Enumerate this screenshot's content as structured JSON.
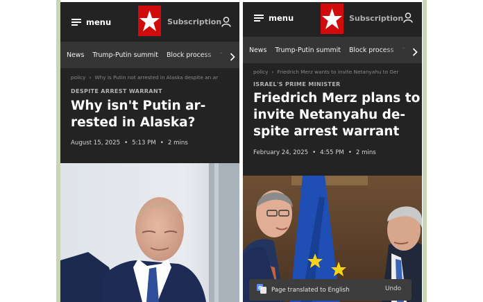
{
  "colors": {
    "background": "#232323",
    "nav_strip": "#353535",
    "logo_red": "#d10b0b",
    "frame_green": "#c9d6b6",
    "eu_flag_blue": "#1f4fb4",
    "eu_star_yellow": "#f6d31a"
  },
  "panels": [
    {
      "menu_label": "menu",
      "menu_icon": "hamburger-icon",
      "logo_icon": "white-star-on-red-logo",
      "subscription_label": "Subscription",
      "account_icon": "user-icon",
      "nav_items": [
        "News",
        "Trump-Putin summit",
        "Block process",
        "“"
      ],
      "nav_more_icon": "chevron-right-icon",
      "breadcrumb": [
        "policy",
        "Why is Putin not arrested in Alaska despite an ar"
      ],
      "kicker": "DESPITE ARREST WARRANT",
      "headline_lines": [
        "Why isn't Putin ar-",
        "rested in Alaska?"
      ],
      "date": "August 15, 2025",
      "time": "5:13 PM",
      "read_time": "2 mins"
    },
    {
      "menu_label": "menu",
      "menu_icon": "hamburger-icon",
      "logo_icon": "white-star-on-red-logo",
      "subscription_label": "Subscription",
      "account_icon": "user-icon",
      "nav_items": [
        "News",
        "Trump-Putin summit",
        "Block process",
        "“"
      ],
      "nav_more_icon": "chevron-right-icon",
      "breadcrumb": [
        "policy",
        "Friedrich Merz wants to invite Netanyahu to Ger"
      ],
      "kicker": "ISRAEL'S PRIME MINISTER",
      "headline_lines": [
        "Friedrich Merz plans to",
        "invite Netanyahu de-",
        "spite arrest warrant"
      ],
      "date": "February 24, 2025",
      "time": "4:55 PM",
      "read_time": "2 mins"
    }
  ],
  "toast": {
    "icon": "google-translate-icon",
    "text": "Page translated to English",
    "undo_label": "Undo"
  }
}
